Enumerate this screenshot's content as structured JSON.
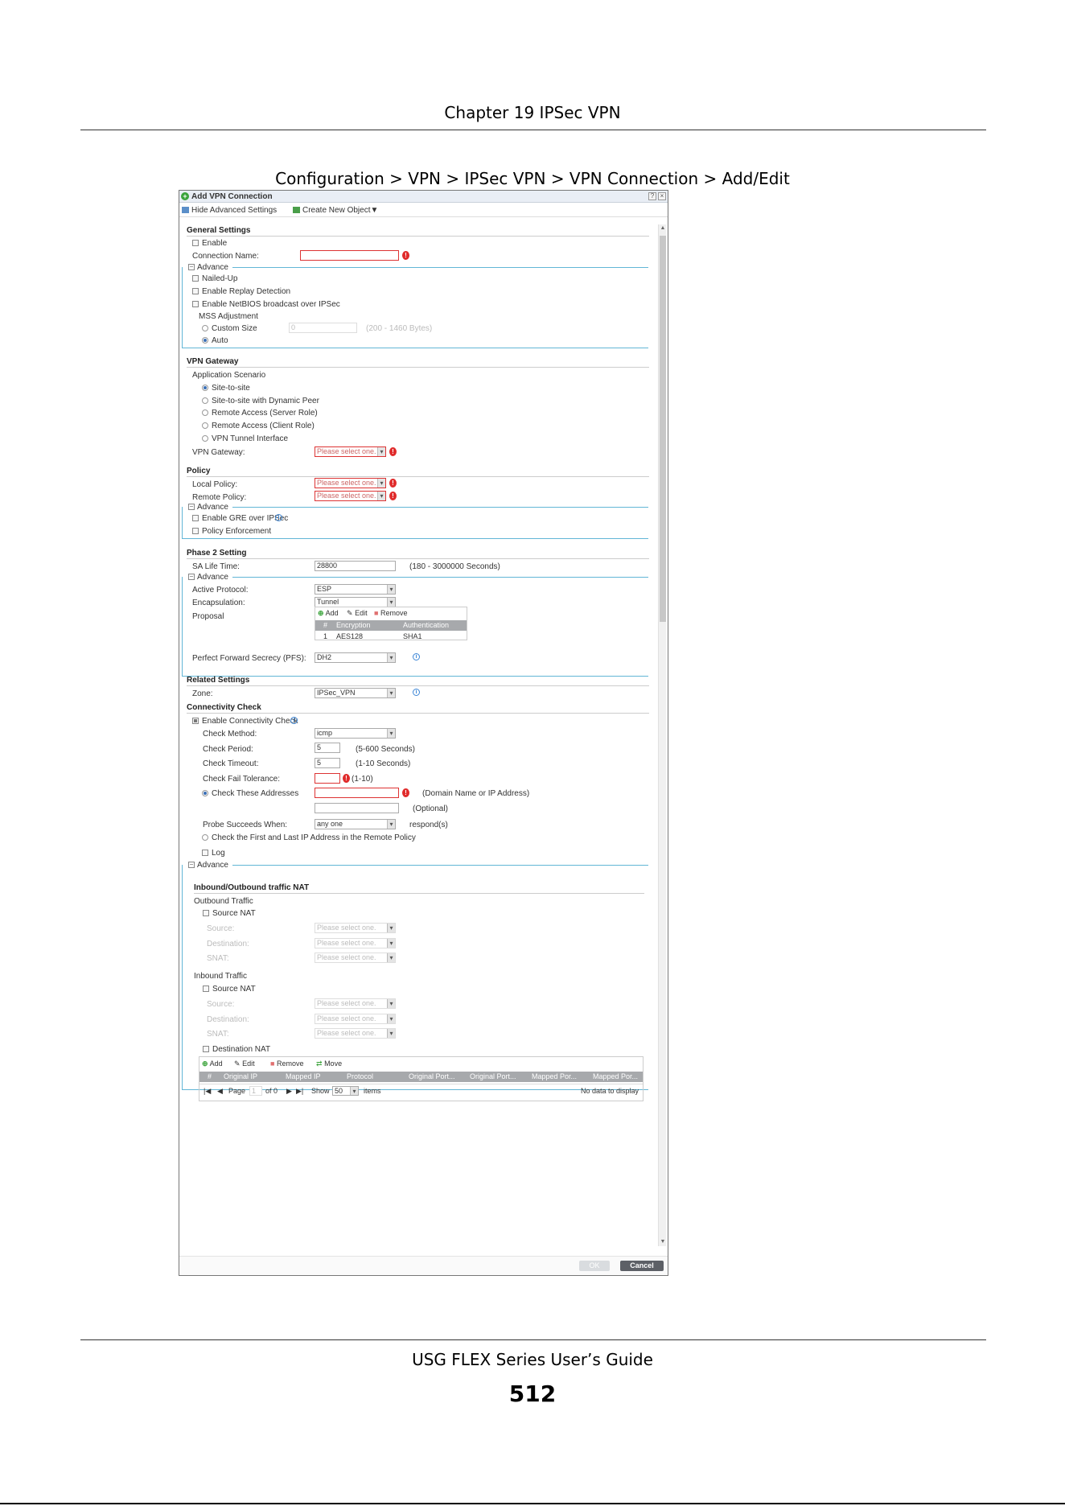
{
  "page": {
    "header": "Chapter 19 IPSec VPN",
    "caption": "Configuration > VPN > IPSec VPN > VPN Connection > Add/Edit",
    "footer_title": "USG FLEX Series User’s Guide",
    "page_number": "512"
  },
  "dialog": {
    "title": "Add VPN Connection",
    "help_button": "?",
    "close_button": "×",
    "toolbar": {
      "hide_advanced": "Hide Advanced Settings",
      "create_object": "Create New Object▼"
    },
    "general": {
      "section": "General Settings",
      "enable": "Enable",
      "connection_name_label": "Connection Name:",
      "advance": "Advance",
      "nailed_up": "Nailed-Up",
      "replay_detection": "Enable Replay Detection",
      "netbios": "Enable NetBIOS broadcast over IPSec",
      "mss_adjustment": "MSS Adjustment",
      "custom_size": "Custom Size",
      "custom_size_value": "0",
      "custom_size_hint": "(200 - 1460 Bytes)",
      "auto": "Auto"
    },
    "gateway": {
      "section": "VPN Gateway",
      "scenario_label": "Application Scenario",
      "scenarios": [
        "Site-to-site",
        "Site-to-site with Dynamic Peer",
        "Remote Access (Server Role)",
        "Remote Access (Client Role)",
        "VPN Tunnel Interface"
      ],
      "gateway_label": "VPN Gateway:",
      "gateway_value": "Please select one."
    },
    "policy": {
      "section": "Policy",
      "local_label": "Local Policy:",
      "local_value": "Please select one.",
      "remote_label": "Remote Policy:",
      "remote_value": "Please select one.",
      "advance": "Advance",
      "gre": "Enable GRE over IPSec",
      "enforcement": "Policy Enforcement"
    },
    "phase2": {
      "section": "Phase 2 Setting",
      "sa_label": "SA Life Time:",
      "sa_value": "28800",
      "sa_hint": "(180 - 3000000 Seconds)",
      "advance": "Advance",
      "protocol_label": "Active Protocol:",
      "protocol_value": "ESP",
      "encap_label": "Encapsulation:",
      "encap_value": "Tunnel",
      "proposal_label": "Proposal",
      "proposal_toolbar": {
        "add": "Add",
        "edit": "Edit",
        "remove": "Remove"
      },
      "proposal_columns": [
        "#",
        "Encryption",
        "Authentication"
      ],
      "proposal_rows": [
        {
          "num": "1",
          "enc": "AES128",
          "auth": "SHA1"
        }
      ],
      "pfs_label": "Perfect Forward Secrecy (PFS):",
      "pfs_value": "DH2"
    },
    "related": {
      "section": "Related Settings",
      "zone_label": "Zone:",
      "zone_value": "IPSec_VPN"
    },
    "connectivity": {
      "section": "Connectivity Check",
      "enable": "Enable Connectivity Check",
      "method_label": "Check Method:",
      "method_value": "icmp",
      "period_label": "Check Period:",
      "period_value": "5",
      "period_hint": "(5-600 Seconds)",
      "timeout_label": "Check Timeout:",
      "timeout_value": "5",
      "timeout_hint": "(1-10 Seconds)",
      "fail_label": "Check Fail Tolerance:",
      "fail_hint": "(1-10)",
      "addresses_label": "Check These Addresses",
      "addresses_hint": "(Domain Name or IP Address)",
      "optional_hint": "(Optional)",
      "probe_label": "Probe Succeeds When:",
      "probe_value": "any one",
      "probe_suffix": "respond(s)",
      "first_last": "Check the First and Last IP Address in the Remote Policy",
      "log": "Log",
      "advance": "Advance"
    },
    "nat": {
      "section": "Inbound/Outbound traffic NAT",
      "outbound_label": "Outbound Traffic",
      "outbound_source_nat": "Source NAT",
      "source_label": "Source:",
      "destination_label": "Destination:",
      "snat_label": "SNAT:",
      "select_placeholder": "Please select one.",
      "inbound_label": "Inbound Traffic",
      "inbound_source_nat": "Source NAT",
      "destination_nat": "Destination NAT",
      "table_toolbar": {
        "add": "Add",
        "edit": "Edit",
        "remove": "Remove",
        "move": "Move"
      },
      "table_columns": [
        "#",
        "Original IP",
        "Mapped IP",
        "Protocol",
        "Original Port...",
        "Original Port...",
        "Mapped Por...",
        "Mapped Por..."
      ],
      "pager": {
        "page_label": "Page",
        "page_value": "1",
        "of_label": "of 0",
        "show_label": "Show",
        "show_value": "50",
        "items_label": "items",
        "empty": "No data to display"
      }
    },
    "buttons": {
      "ok": "OK",
      "cancel": "Cancel"
    }
  }
}
